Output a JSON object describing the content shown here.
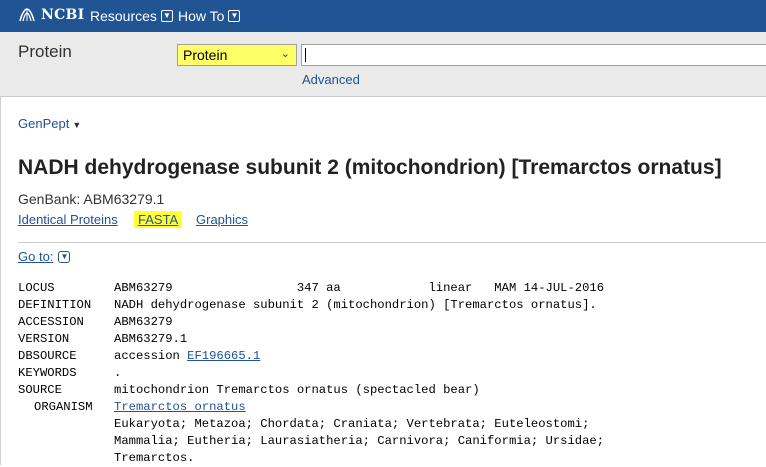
{
  "topnav": {
    "logo": "NCBI",
    "resources": "Resources",
    "howto": "How To"
  },
  "search": {
    "db_title": "Protein",
    "db_selected": "Protein",
    "query": "",
    "advanced": "Advanced"
  },
  "record": {
    "report_format": "GenPept",
    "title": "NADH dehydrogenase subunit 2 (mitochondrion) [Tremarctos ornatus]",
    "genbank_line": "GenBank: ABM63279.1",
    "links": {
      "identical": "Identical Proteins",
      "fasta": "FASTA",
      "graphics": "Graphics"
    },
    "goto": "Go to:"
  },
  "flatfile": {
    "locus_key": "LOCUS",
    "locus_val": "ABM63279                 347 aa            linear   MAM 14-JUL-2016",
    "definition_key": "DEFINITION",
    "definition_val": "NADH dehydrogenase subunit 2 (mitochondrion) [Tremarctos ornatus].",
    "accession_key": "ACCESSION",
    "accession_val": "ABM63279",
    "version_key": "VERSION",
    "version_val": "ABM63279.1",
    "dbsource_key": "DBSOURCE",
    "dbsource_prefix": "accession ",
    "dbsource_link": "EF196665.1",
    "keywords_key": "KEYWORDS",
    "keywords_val": ".",
    "source_key": "SOURCE",
    "source_val": "mitochondrion Tremarctos ornatus (spectacled bear)",
    "organism_key": "ORGANISM",
    "organism_link": "Tremarctos ornatus",
    "lineage": [
      "Eukaryota; Metazoa; Chordata; Craniata; Vertebrata; Euteleostomi;",
      "Mammalia; Eutheria; Laurasiatheria; Carnivora; Caniformia; Ursidae;",
      "Tremarctos."
    ]
  }
}
